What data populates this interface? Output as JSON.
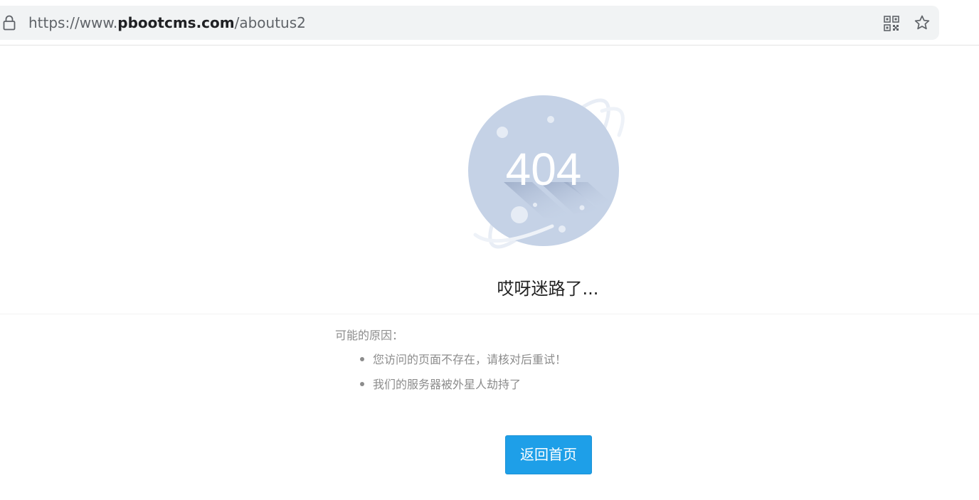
{
  "browser": {
    "url_scheme_prefix": "https://www.",
    "url_host": "pbootcms.com",
    "url_path": "/aboutus2",
    "icons": [
      "lock-icon",
      "qr-code-icon",
      "star-icon"
    ]
  },
  "error_page": {
    "code": "404",
    "headline": "哎呀迷路了...",
    "reasons_title": "可能的原因：",
    "reasons": [
      "您访问的页面不存在，请核对后重试！",
      "我们的服务器被外星人劫持了"
    ],
    "home_button_label": "返回首页"
  },
  "colors": {
    "accent": "#1e9fe8",
    "planet": "#c5d2e6",
    "muted_text": "#8c8c8c"
  }
}
